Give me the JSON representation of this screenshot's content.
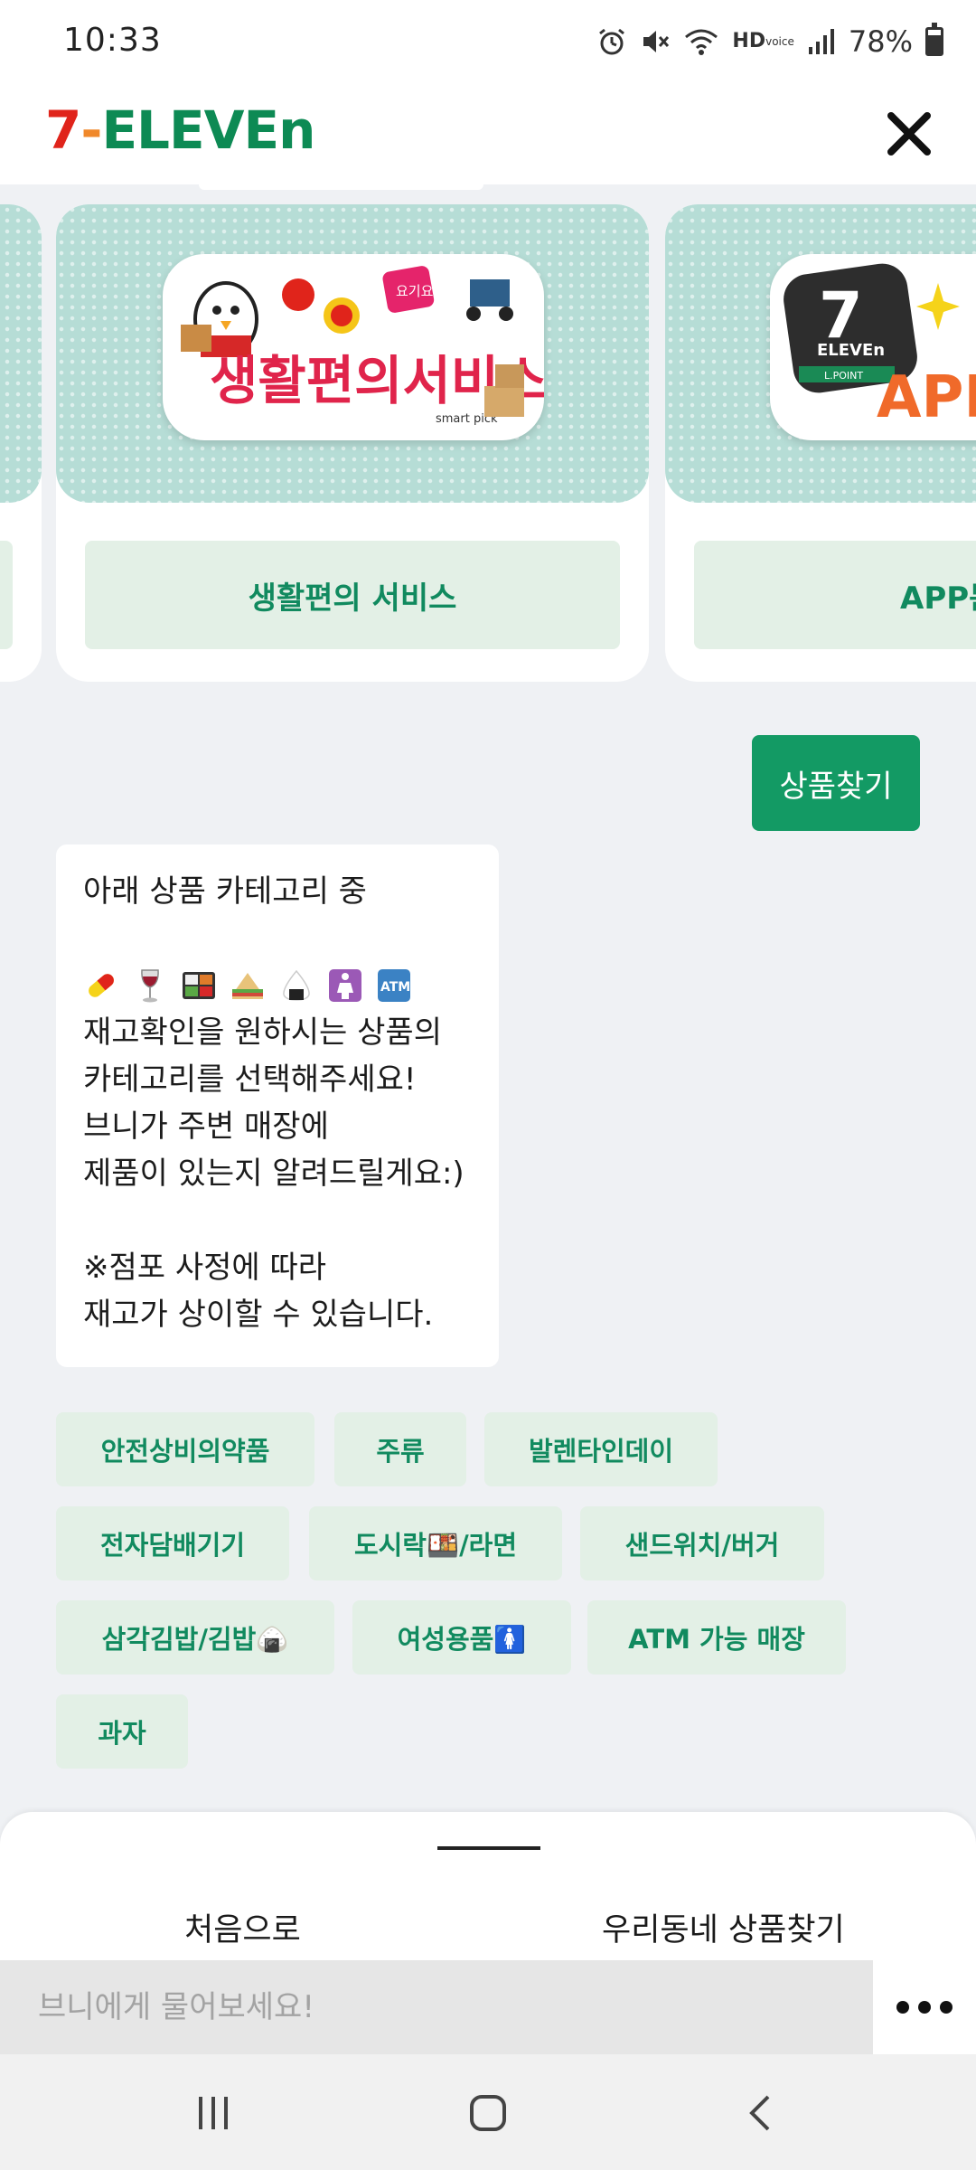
{
  "status_bar": {
    "time": "10:33",
    "hd_label": "HD",
    "hd_sub": "voice",
    "battery": "78%",
    "battery_level": 0.78
  },
  "header": {
    "logo_seven": "7",
    "logo_dash": "-",
    "logo_eleven": "ELEVEn",
    "icons": [
      "close-icon"
    ]
  },
  "carousel": {
    "cards": [
      {
        "label": "생활편의 서비스",
        "banner_text": "생활편의서비스",
        "sub_brand": "smart pick",
        "badge": "요기요"
      },
      {
        "label": "APP문",
        "banner_text": "APP",
        "badge": "ELEVEn",
        "sub_badge": "L.POINT"
      }
    ]
  },
  "user_message": "상품찾기",
  "bot_message": {
    "line1": "아래 상품 카테고리 중",
    "emojis": [
      "pill",
      "wine-glass",
      "bento",
      "sandwich",
      "rice-ball",
      "female-sign",
      "atm"
    ],
    "line2": "재고확인을 원하시는 상품의",
    "line3": "카테고리를 선택해주세요!",
    "line4": "브니가 주변 매장에",
    "line5": "제품이 있는지 알려드릴게요:)",
    "line6": "※점포 사정에 따라",
    "line7": "재고가 상이할 수 있습니다."
  },
  "chips": [
    "안전상비의약품",
    "주류",
    "발렌타인데이",
    "전자담배기기",
    "도시락🍱/라면",
    "샌드위치/버거",
    "삼각김밥/김밥🍙",
    "여성용품🚺",
    "ATM 가능 매장",
    "과자"
  ],
  "bottom_sheet": {
    "home_link": "처음으로",
    "find_link": "우리동네 상품찾기",
    "input_placeholder": "브니에게 물어보세요!"
  },
  "colors": {
    "brand_green": "#139a64",
    "chip_bg": "#e3f0e6",
    "chip_text": "#118a5f",
    "banner_teal": "#b6ddd6",
    "logo_red": "#e0241b",
    "logo_orange": "#f0882a",
    "logo_green": "#0d8a54"
  }
}
